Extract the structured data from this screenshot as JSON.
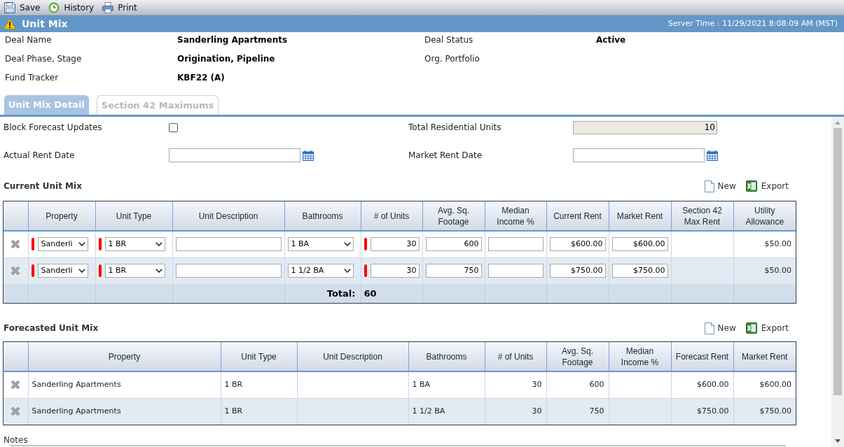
{
  "toolbar": [
    {
      "kind": "save",
      "label": "Save"
    },
    {
      "kind": "history",
      "label": "History"
    },
    {
      "kind": "print",
      "label": "Print"
    }
  ],
  "header": {
    "title": "Unit Mix",
    "server_time": "Server Time : 11/29/2021 8:08:09 AM (MST)"
  },
  "deal_info": [
    {
      "label": "Deal Name",
      "value": "Sanderling Apartments"
    },
    {
      "label": "Deal Status",
      "value": "Active"
    },
    {
      "label": "Deal Phase, Stage",
      "value": "Origination, Pipeline"
    },
    {
      "label": "Org. Portfolio"
    },
    {
      "label": "Fund Tracker",
      "value": "KBF22 (A)"
    }
  ],
  "tabs": [
    {
      "label": "Unit Mix Detail",
      "selected": true
    },
    {
      "label": "Section 42 Maximums",
      "selected": false
    }
  ],
  "settings": [
    {
      "kind": "checkbox",
      "label": "Block Forecast Updates",
      "checked": false
    },
    {
      "kind": "readonly",
      "label": "Total Residential Units",
      "value": "10"
    },
    {
      "kind": "date",
      "label": "Actual Rent Date"
    },
    {
      "kind": "date",
      "label": "Market Rent Date"
    }
  ],
  "current_unit_mix": {
    "title": "Current Unit Mix",
    "actions": [
      {
        "kind": "new",
        "label": "New"
      },
      {
        "kind": "export",
        "label": "Export"
      }
    ],
    "columns": [
      {
        "label": "Property",
        "kind": "select",
        "required": true
      },
      {
        "label": "Unit Type",
        "kind": "select",
        "required": true
      },
      {
        "label": "Unit Description",
        "kind": "textbox"
      },
      {
        "label": "Bathrooms",
        "kind": "select"
      },
      {
        "label": "# of Units",
        "kind": "numberbox",
        "required": true,
        "total": "60"
      },
      {
        "label": "Avg. Sq.\nFootage",
        "kind": "numberbox"
      },
      {
        "label": "Median\nIncome %",
        "kind": "numberbox"
      },
      {
        "label": "Current Rent",
        "kind": "numberbox"
      },
      {
        "label": "Market Rent",
        "kind": "numberbox"
      },
      {
        "label": "Section 42\nMax Rent",
        "kind": "number"
      },
      {
        "label": "Utility\nAllowance",
        "kind": "number"
      }
    ],
    "rows": [
      {
        "cells": [
          "Sanderli",
          "1 BR",
          null,
          "1 BA",
          "30",
          "600",
          null,
          "$600.00",
          "$600.00",
          null,
          "$50.00"
        ]
      },
      {
        "cells": [
          "Sanderli",
          "1 BR",
          null,
          "1 1/2 BA",
          "30",
          "750",
          null,
          "$750.00",
          "$750.00",
          null,
          "$50.00"
        ]
      }
    ],
    "total_label": "Total:"
  },
  "forecasted_unit_mix": {
    "title": "Forecasted Unit Mix",
    "actions": [
      {
        "kind": "new",
        "label": "New"
      },
      {
        "kind": "export",
        "label": "Export"
      }
    ],
    "columns": [
      {
        "label": "Property",
        "kind": "text"
      },
      {
        "label": "Unit Type",
        "kind": "text"
      },
      {
        "label": "Unit Description",
        "kind": "text"
      },
      {
        "label": "Bathrooms",
        "kind": "text"
      },
      {
        "label": "# of Units",
        "kind": "number"
      },
      {
        "label": "Avg. Sq.\nFootage",
        "kind": "number"
      },
      {
        "label": "Median\nIncome %",
        "kind": "number"
      },
      {
        "label": "Forecast Rent",
        "kind": "number"
      },
      {
        "label": "Market Rent",
        "kind": "number"
      }
    ],
    "rows": [
      {
        "cells": [
          "Sanderling Apartments",
          "1 BR",
          null,
          "1 BA",
          "30",
          "600",
          null,
          "$600.00",
          "$600.00"
        ]
      },
      {
        "cells": [
          "Sanderling Apartments",
          "1 BR",
          null,
          "1 1/2 BA",
          "30",
          "750",
          null,
          "$750.00",
          "$750.00"
        ]
      }
    ]
  },
  "notes": {
    "label": "Notes"
  }
}
